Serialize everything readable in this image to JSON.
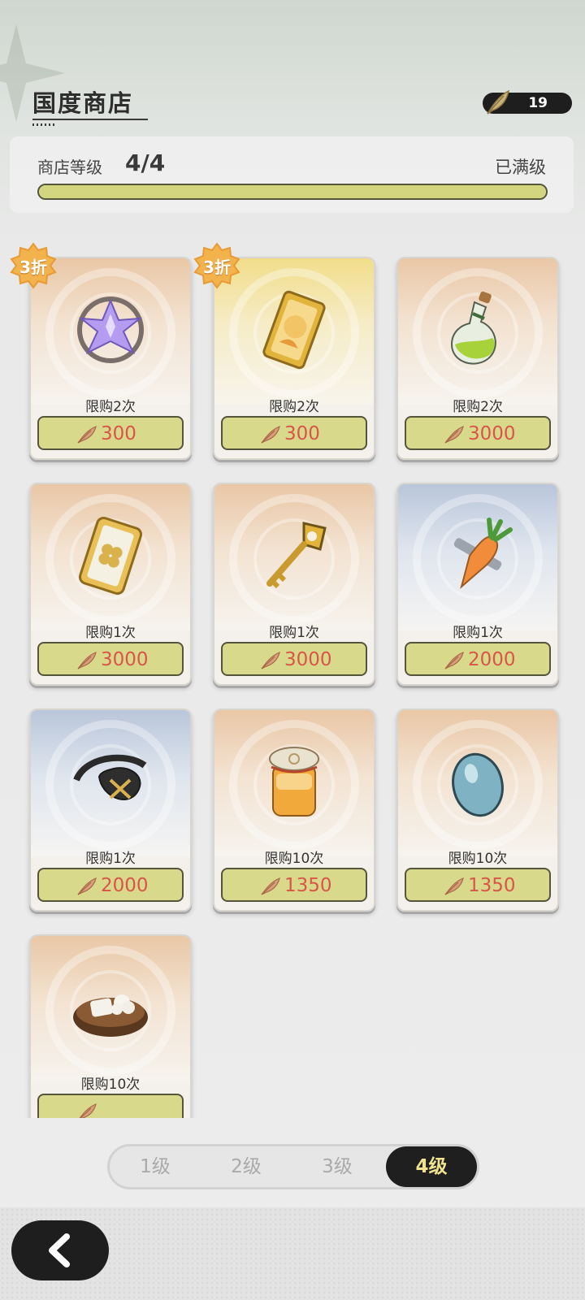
{
  "header": {
    "title": "国度商店",
    "currency_icon": "feather-icon",
    "currency_count": "19"
  },
  "level": {
    "label": "商店等级",
    "value": "4/4",
    "status": "已满级",
    "progress": 1.0
  },
  "items": [
    {
      "name": "crystal-item",
      "limit": "限购2次",
      "price": "300",
      "discount": "3折",
      "bg": "orange"
    },
    {
      "name": "card-item",
      "limit": "限购2次",
      "price": "300",
      "discount": "3折",
      "bg": "gold"
    },
    {
      "name": "potion-item",
      "limit": "限购2次",
      "price": "3000",
      "discount": "",
      "bg": "orange"
    },
    {
      "name": "clover-ticket-item",
      "limit": "限购1次",
      "price": "3000",
      "discount": "",
      "bg": "orange"
    },
    {
      "name": "key-item",
      "limit": "限购1次",
      "price": "3000",
      "discount": "",
      "bg": "orange"
    },
    {
      "name": "carrot-item",
      "limit": "限购1次",
      "price": "2000",
      "discount": "",
      "bg": "blue"
    },
    {
      "name": "eyepatch-item",
      "limit": "限购1次",
      "price": "2000",
      "discount": "",
      "bg": "blue"
    },
    {
      "name": "honey-jar-item",
      "limit": "限购10次",
      "price": "1350",
      "discount": "",
      "bg": "orange"
    },
    {
      "name": "egg-item",
      "limit": "限购10次",
      "price": "1350",
      "discount": "",
      "bg": "orange"
    },
    {
      "name": "tofu-bowl-item",
      "limit": "限购10次",
      "price": "",
      "discount": "",
      "bg": "orange"
    }
  ],
  "tabs": [
    {
      "label": "1级",
      "active": false
    },
    {
      "label": "2级",
      "active": false
    },
    {
      "label": "3级",
      "active": false
    },
    {
      "label": "4级",
      "active": true
    }
  ],
  "colors": {
    "price_text": "#d9554a",
    "price_button": "#d9d98b",
    "active_tab_text": "#f0e28e",
    "discount_badge": "#f2b24c"
  }
}
